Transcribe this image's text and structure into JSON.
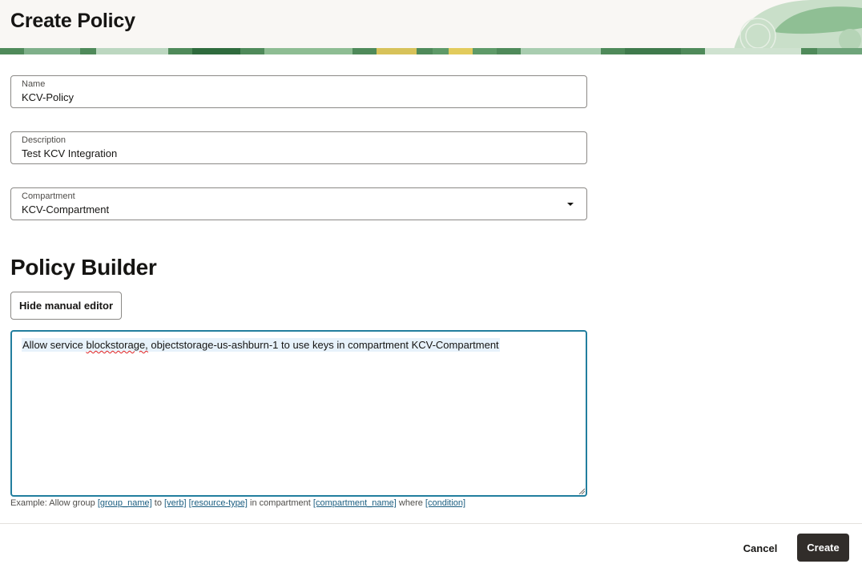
{
  "header": {
    "title": "Create Policy"
  },
  "form": {
    "name": {
      "label": "Name",
      "value": "KCV-Policy"
    },
    "description": {
      "label": "Description",
      "value": "Test KCV Integration"
    },
    "compartment": {
      "label": "Compartment",
      "value": "KCV-Compartment"
    }
  },
  "policy_builder": {
    "title": "Policy Builder",
    "toggle_label": "Hide manual editor",
    "statement_prefix": "Allow service ",
    "statement_misspelled": "blockstorage,",
    "statement_suffix": " objectstorage-us-ashburn-1 to use keys in compartment KCV-Compartment",
    "example": {
      "prefix": "Example: Allow group ",
      "group_name": "[group_name]",
      "to": " to ",
      "verb": "[verb]",
      "space": " ",
      "resource_type": "[resource-type]",
      "in_compartment": " in compartment ",
      "compartment_name": "[compartment_name]",
      "where": " where ",
      "condition": "[condition]"
    }
  },
  "footer": {
    "cancel_label": "Cancel",
    "create_label": "Create"
  },
  "colors": {
    "primary_button": "#312d2a",
    "focus_border": "#227e9e",
    "link": "#1b5e81",
    "header_bg": "#f9f7f4"
  }
}
